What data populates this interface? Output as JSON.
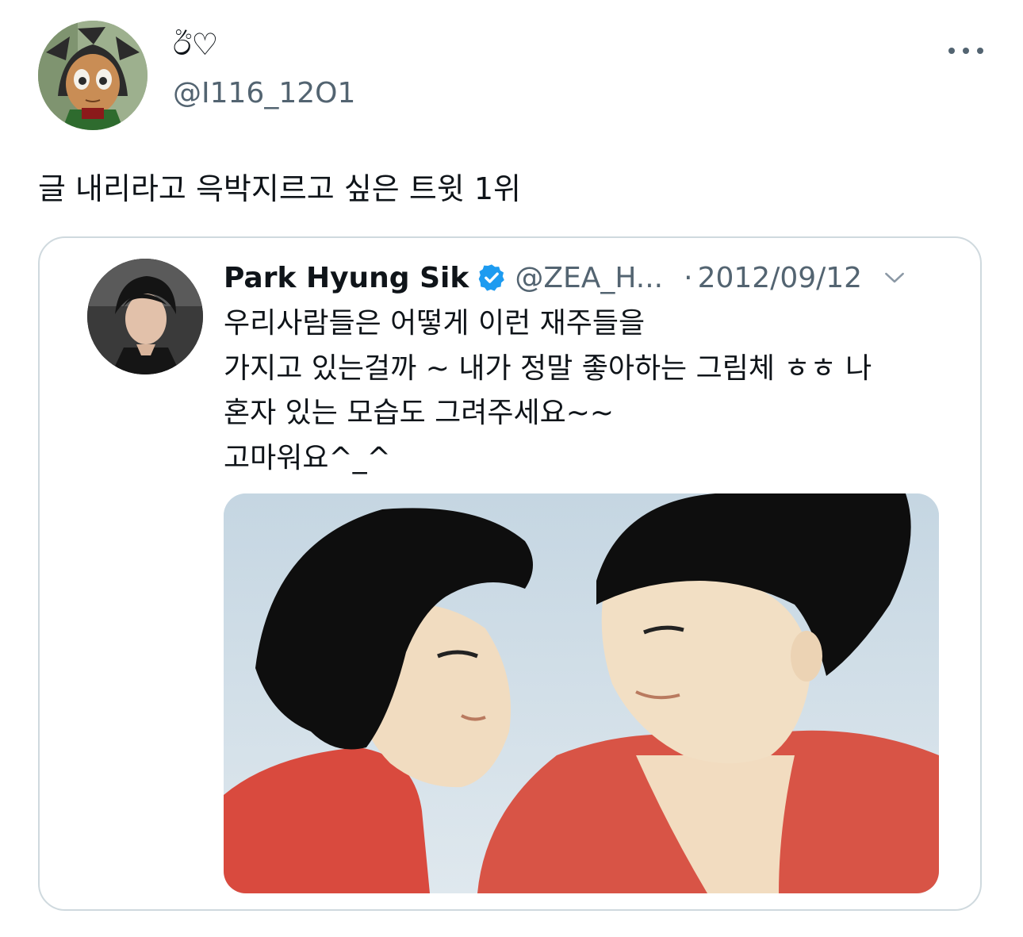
{
  "tweet": {
    "display_name": "ඊ♡",
    "handle": "@I116_12O1",
    "text": "글 내리라고 윽박지르고 싶은 트윗 1위"
  },
  "quoted_tweet": {
    "name": "Park Hyung Sik",
    "handle": "@ZEA_H...",
    "dot": "·",
    "date": "2012/09/12",
    "lines": [
      "우리사람들은 어떻게 이런 재주들을",
      "가지고 있는걸까 ~ 내가 정말 좋아하는 그림체 ㅎㅎ 나",
      "혼자 있는 모습도 그려주세요~~",
      "고마워요^_^"
    ]
  },
  "colors": {
    "verified": "#1d9bf0",
    "secondary_text": "#536471",
    "border": "#cfd9de"
  }
}
